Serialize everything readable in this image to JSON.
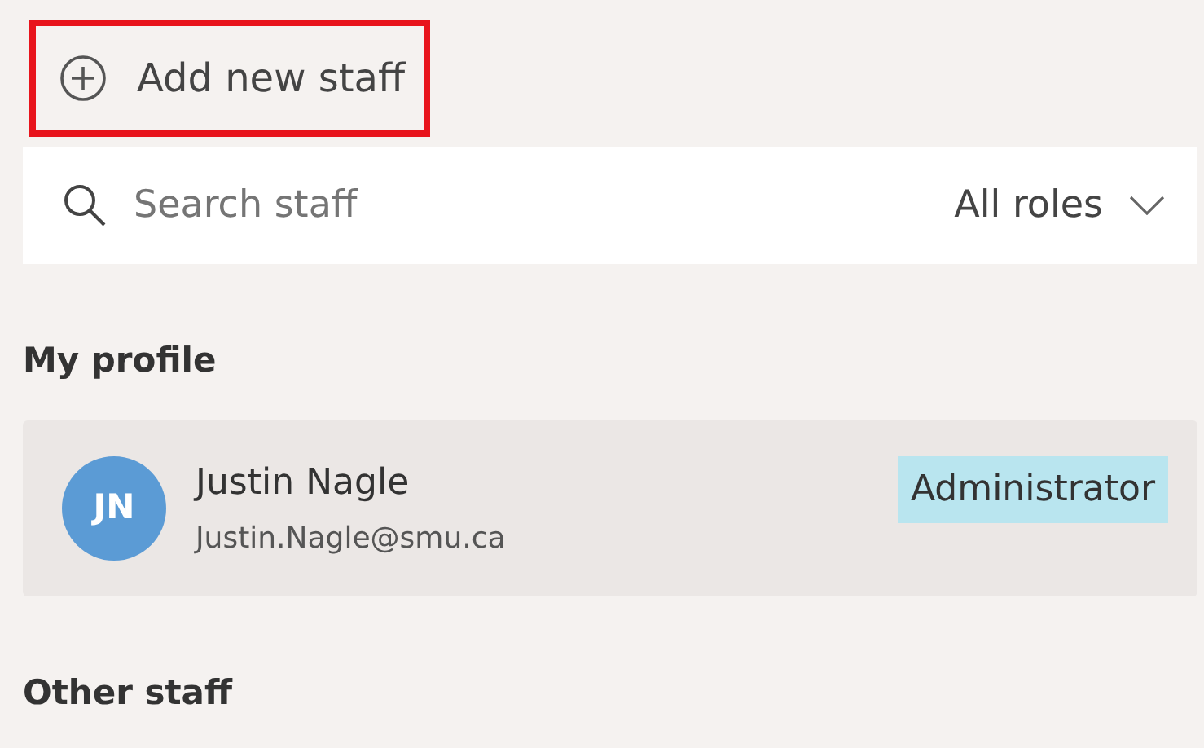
{
  "add_button": {
    "label": "Add new staff",
    "highlighted": true
  },
  "search": {
    "placeholder": "Search staff",
    "role_filter": "All roles"
  },
  "sections": [
    {
      "title": "My profile",
      "staff": [
        {
          "initials": "JN",
          "name": "Justin Nagle",
          "email": "Justin.Nagle@smu.ca",
          "role": "Administrator",
          "color": "#5b9bd5"
        }
      ]
    },
    {
      "title": "Other staff"
    }
  ]
}
